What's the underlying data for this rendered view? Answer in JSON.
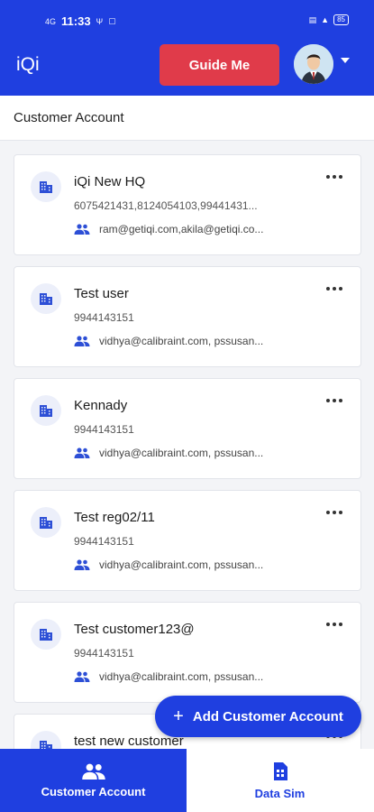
{
  "status": {
    "time": "11:33",
    "signal": "4G",
    "battery": "85"
  },
  "header": {
    "brand": "iQi",
    "guide_label": "Guide Me"
  },
  "section": {
    "title": "Customer Account"
  },
  "customers": [
    {
      "name": "iQi New HQ",
      "phone": "6075421431,8124054103,99441431...",
      "emails": "ram@getiqi.com,akila@getiqi.co..."
    },
    {
      "name": "Test user",
      "phone": "9944143151",
      "emails": "vidhya@calibraint.com, pssusan..."
    },
    {
      "name": "Kennady",
      "phone": "9944143151",
      "emails": "vidhya@calibraint.com, pssusan..."
    },
    {
      "name": "Test reg02/11",
      "phone": "9944143151",
      "emails": "vidhya@calibraint.com, pssusan..."
    },
    {
      "name": "Test customer123@",
      "phone": "9944143151",
      "emails": "vidhya@calibraint.com, pssusan..."
    },
    {
      "name": "test new customer",
      "phone": "",
      "emails": ""
    }
  ],
  "fab": {
    "label": "Add Customer Account"
  },
  "bottom_nav": [
    {
      "label": "Customer Account",
      "icon": "people-icon"
    },
    {
      "label": "Data Sim",
      "icon": "sim-card-icon"
    }
  ],
  "colors": {
    "primary": "#1f3fe0",
    "guide": "#e03b4a"
  }
}
